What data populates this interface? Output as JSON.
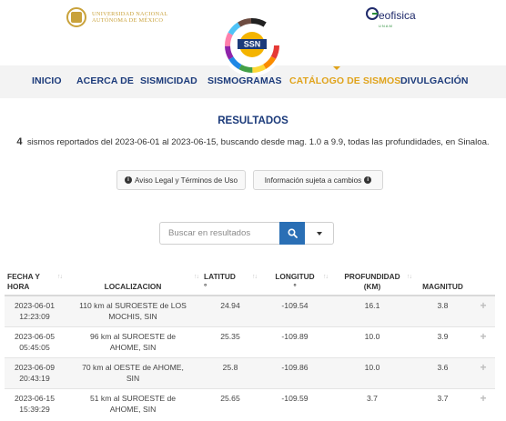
{
  "header": {
    "unam_line1": "UNIVERSIDAD NACIONAL",
    "unam_line2": "AUTÓNOMA DE MÉXICO",
    "geofisica_text": "eofisica",
    "geofisica_sub": "UNAM",
    "ssn_logo_text": "SSN"
  },
  "nav": {
    "items": [
      {
        "label": "INICIO"
      },
      {
        "label": "ACERCA DE"
      },
      {
        "label": "SISMICIDAD"
      },
      {
        "label": "SISMOGRAMAS"
      },
      {
        "label": "CATÁLOGO DE SISMOS"
      },
      {
        "label": "DIVULGACIÓN"
      }
    ],
    "active_index": 4
  },
  "results": {
    "title": "RESULTADOS",
    "count": "4",
    "summary_text": "sismos reportados del 2023-06-01 al 2023-06-15, buscando desde mag. 1.0 a 9.9, todas las profundidades, en Sinaloa.",
    "legal_button": "Aviso Legal y Términos de Uso",
    "info_button": "Información sujeta a cambios"
  },
  "search": {
    "placeholder": "Buscar en resultados"
  },
  "table": {
    "headers": {
      "fecha_line1": "FECHA Y",
      "fecha_line2": "HORA",
      "localizacion": "LOCALIZACION",
      "latitud_line1": "LATITUD",
      "latitud_line2": "°",
      "longitud_line1": "LONGITUD",
      "longitud_line2": "°",
      "profundidad_line1": "PROFUNDIDAD",
      "profundidad_line2": "(KM)",
      "magnitud": "MAGNITUD"
    },
    "rows": [
      {
        "date": "2023-06-01",
        "time": "12:23:09",
        "loc1": "110 km al SUROESTE de LOS",
        "loc2": "MOCHIS, SIN",
        "lat": "24.94",
        "lon": "-109.54",
        "depth": "16.1",
        "mag": "3.8"
      },
      {
        "date": "2023-06-05",
        "time": "05:45:05",
        "loc1": "96 km al SUROESTE de",
        "loc2": "AHOME, SIN",
        "lat": "25.35",
        "lon": "-109.89",
        "depth": "10.0",
        "mag": "3.9"
      },
      {
        "date": "2023-06-09",
        "time": "20:43:19",
        "loc1": "70 km al OESTE de AHOME,",
        "loc2": "SIN",
        "lat": "25.8",
        "lon": "-109.86",
        "depth": "10.0",
        "mag": "3.6"
      },
      {
        "date": "2023-06-15",
        "time": "15:39:29",
        "loc1": "51 km al SUROESTE de",
        "loc2": "AHOME, SIN",
        "lat": "25.65",
        "lon": "-109.59",
        "depth": "3.7",
        "mag": "3.7"
      }
    ]
  },
  "colors": {
    "nav_text": "#1b3a7a",
    "nav_active": "#e0a31b",
    "search_button": "#2a6fb5",
    "magnitude": "#e8b220"
  }
}
